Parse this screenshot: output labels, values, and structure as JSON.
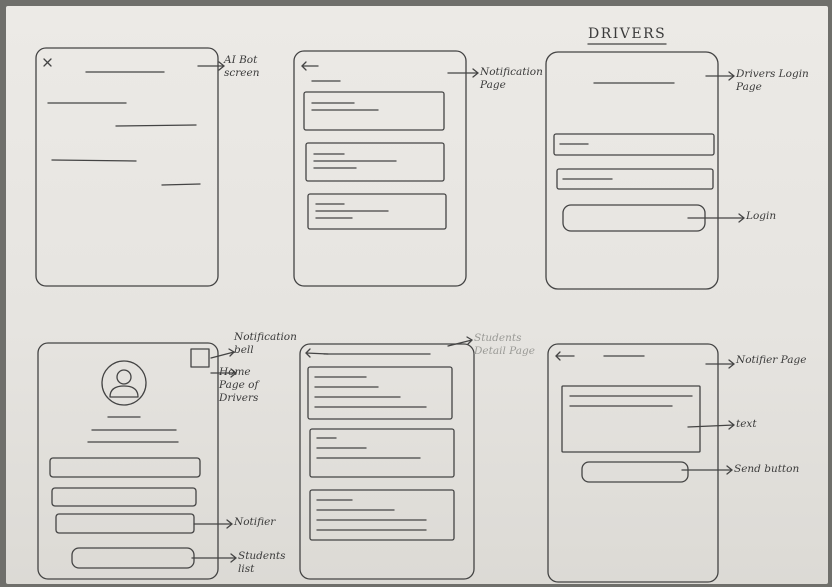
{
  "section_title": "DRIVERS",
  "screens": {
    "ai_bot": {
      "close_icon": "x",
      "annotation": "AI Bot screen"
    },
    "notification_page": {
      "back_icon": "arrow-left",
      "annotation": "Notification Page"
    },
    "drivers_login": {
      "annotation": "Drivers Login Page",
      "login_annotation": "Login"
    },
    "home_page": {
      "avatar_icon": "user-icon",
      "bell_annotation": "Notification bell",
      "annotation": "Home Page of Drivers",
      "notifier_annotation": "Notifier",
      "students_list_annotation": "Students list"
    },
    "students_detail": {
      "annotation": "Students Detail Page"
    },
    "notifier_page": {
      "back_icon": "arrow-left",
      "annotation": "Notifier Page",
      "text_annotation": "text",
      "send_annotation": "Send button"
    }
  },
  "colors": {
    "paper": "#e8e6e2",
    "ink": "#3b3b3b",
    "backdrop": "#6f6f6b"
  }
}
